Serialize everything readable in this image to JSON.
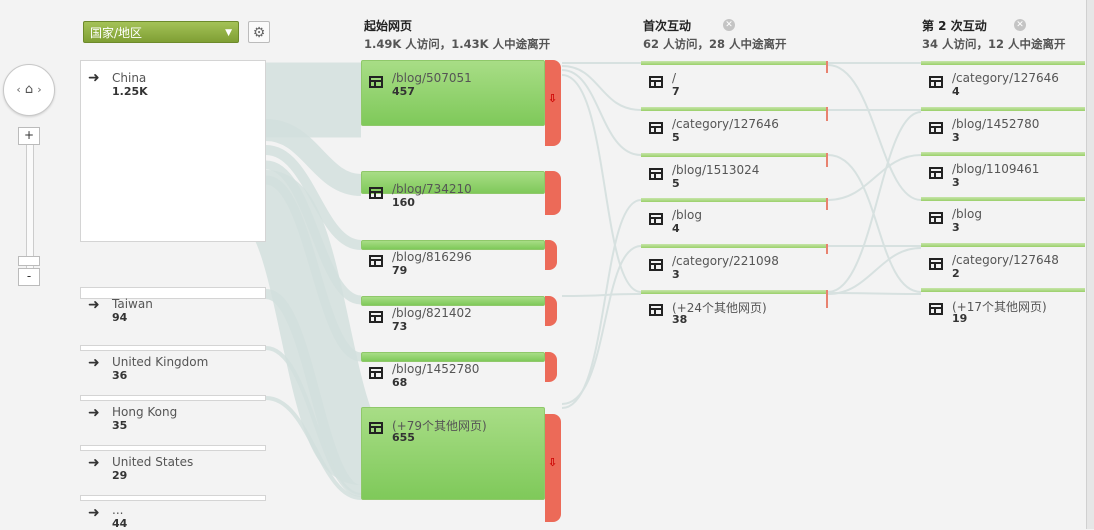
{
  "toolbar": {
    "dimension_select": "国家/地区",
    "settings_icon": "gear-icon"
  },
  "zoom": {
    "plus": "+",
    "minus": "-",
    "home_icon": "home-icon"
  },
  "columns": [
    {
      "title": "起始网页",
      "subtitle": "1.49K 人访问，1.43K 人中途离开"
    },
    {
      "title": "首次互动",
      "subtitle": "62 人访问，28 人中途离开"
    },
    {
      "title": "第 2 次互动",
      "subtitle": "34 人访问，12 人中途离开"
    }
  ],
  "countries": [
    {
      "name": "China",
      "value": "1.25K"
    },
    {
      "name": "Taiwan",
      "value": "94"
    },
    {
      "name": "United Kingdom",
      "value": "36"
    },
    {
      "name": "Hong Kong",
      "value": "35"
    },
    {
      "name": "United States",
      "value": "29"
    },
    {
      "name": "...",
      "value": "44"
    }
  ],
  "start_pages": [
    {
      "name": "/blog/507051",
      "value": "457"
    },
    {
      "name": "/blog/734210",
      "value": "160"
    },
    {
      "name": "/blog/816296",
      "value": "79"
    },
    {
      "name": "/blog/821402",
      "value": "73"
    },
    {
      "name": "/blog/1452780",
      "value": "68"
    },
    {
      "name": "(+79个其他网页)",
      "value": "655"
    }
  ],
  "first_interaction": [
    {
      "name": "/",
      "value": "7"
    },
    {
      "name": "/category/127646",
      "value": "5"
    },
    {
      "name": "/blog/1513024",
      "value": "5"
    },
    {
      "name": "/blog",
      "value": "4"
    },
    {
      "name": "/category/221098",
      "value": "3"
    },
    {
      "name": "(+24个其他网页)",
      "value": "38"
    }
  ],
  "second_interaction": [
    {
      "name": "/category/127646",
      "value": "4"
    },
    {
      "name": "/blog/1452780",
      "value": "3"
    },
    {
      "name": "/blog/1109461",
      "value": "3"
    },
    {
      "name": "/blog",
      "value": "3"
    },
    {
      "name": "/category/127648",
      "value": "2"
    },
    {
      "name": "(+17个其他网页)",
      "value": "19"
    }
  ],
  "colors": {
    "page_green": "#8fd16a",
    "dropoff_red": "#ec6a58",
    "flow_gray": "#d3dedd"
  }
}
